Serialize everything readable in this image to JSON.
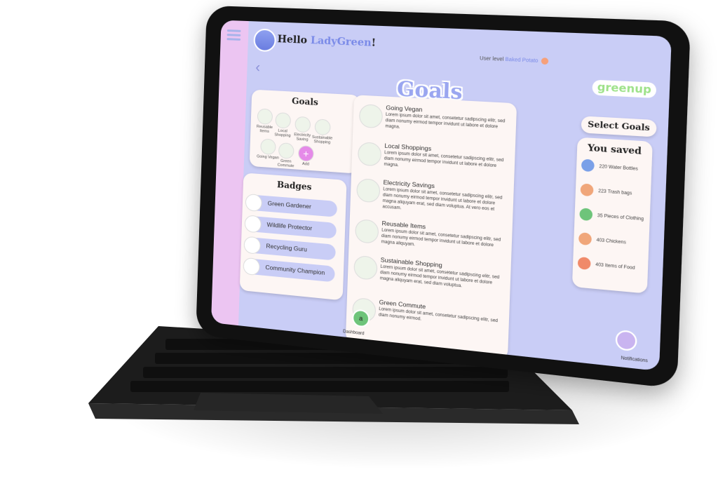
{
  "header": {
    "greeting": "Hello",
    "username": "LadyGreen",
    "exclaim": "!",
    "user_level_label": "User level",
    "user_level_value": "Baked Potato"
  },
  "logo": "greenup",
  "page_title": "Goals",
  "goals_panel": {
    "title": "Goals",
    "items": [
      {
        "label": "Reusable Items"
      },
      {
        "label": "Local Shopping"
      },
      {
        "label": "Electricity Saving"
      },
      {
        "label": "Sustainable Shopping"
      },
      {
        "label": "Going Vegan"
      },
      {
        "label": "Green Commute"
      },
      {
        "label": "Add"
      }
    ]
  },
  "badges_panel": {
    "title": "Badges",
    "items": [
      {
        "label": "Green Gardener"
      },
      {
        "label": "Wildlife Protector"
      },
      {
        "label": "Recycling Guru"
      },
      {
        "label": "Community Champion"
      }
    ]
  },
  "goal_list": [
    {
      "title": "Going Vegan",
      "desc": "Lorem ipsum dolor sit amet, consetetur sadipscing elitr, sed diam nonumy eirmod tempor invidunt ut labore et dolore magna."
    },
    {
      "title": "Local Shoppings",
      "desc": "Lorem ipsum dolor sit amet, consetetur sadipscing elitr, sed diam nonumy eirmod tempor invidunt ut labore et dolore magna."
    },
    {
      "title": "Electricity Savings",
      "desc": "Lorem ipsum dolor sit amet, consetetur sadipscing elitr, sed diam nonumy eirmod tempor invidunt ut labore et dolore magna aliquyam erat, sed diam voluptua. At vero eos et accusam."
    },
    {
      "title": "Reusable Items",
      "desc": "Lorem ipsum dolor sit amet, consetetur sadipscing elitr, sed diam nonumy eirmod tempor invidunt ut labore et dolore magna aliquyam."
    },
    {
      "title": "Sustainable Shopping",
      "desc": "Lorem ipsum dolor sit amet, consetetur sadipscing elitr, sed diam nonumy eirmod tempor invidunt ut labore et dolore magna aliquyam erat, sed diam voluptua."
    },
    {
      "title": "Green Commute",
      "desc": "Lorem ipsum dolor sit amet, consetetur sadipscing elitr, sed diam nonumy eirmod."
    }
  ],
  "select_goals": "Select Goals",
  "saved_panel": {
    "title": "You saved",
    "items": [
      {
        "label": "220 Water Bottles",
        "color": "#7aa0e8"
      },
      {
        "label": "223 Trash bags",
        "color": "#f0a67a"
      },
      {
        "label": "35 Pieces of Clothing",
        "color": "#6ec47a"
      },
      {
        "label": "403 Chickens",
        "color": "#f0a67a"
      },
      {
        "label": "403 Items of Food",
        "color": "#f08a6a"
      }
    ]
  },
  "nav": {
    "dashboard_label": "Dashboard",
    "dashboard_icon": "a",
    "notifications_label": "Notifications"
  },
  "colors": {
    "screen_bg": "#c9cdf6",
    "accent": "#7a8ae8",
    "side_strip": "#ecc5f2",
    "card_bg": "#fdf6f4"
  }
}
